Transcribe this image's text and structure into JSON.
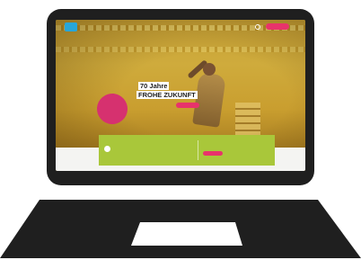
{
  "website": {
    "logo_text": "",
    "nav": {
      "items": [
        "",
        "",
        "",
        ""
      ],
      "cta_label": ""
    },
    "hero": {
      "headline_line1": "70 Jahre",
      "headline_line2": "FROHE ZUKUNFT",
      "cta_label": "",
      "badge_text": ""
    },
    "banner": {
      "title": "",
      "subtitle": "",
      "col1_label": "",
      "col2_label": "",
      "button_label": ""
    }
  },
  "colors": {
    "laptop": "#1f1f1f",
    "hero_yellow": "#c9a63a",
    "accent_pink": "#e8336b",
    "banner_green": "#a9c73a",
    "logo_blue": "#27a6d9"
  }
}
